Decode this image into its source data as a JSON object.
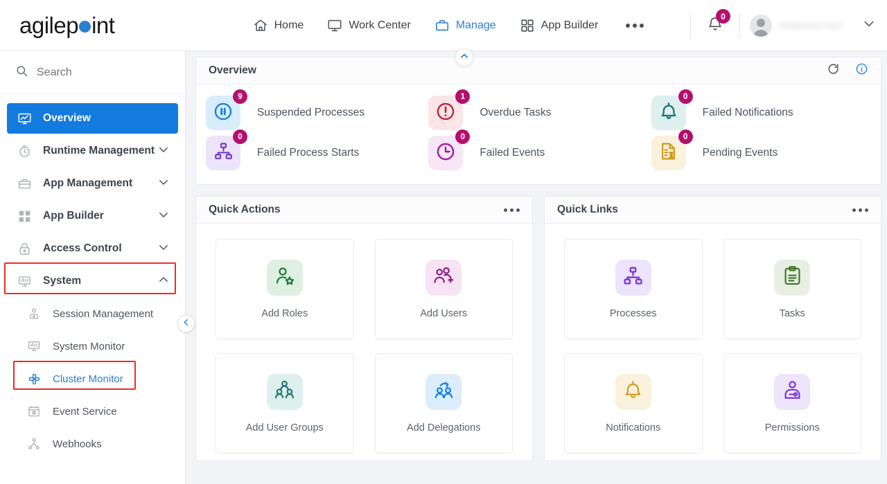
{
  "brand": {
    "name_part1": "agilep",
    "name_part2": "int",
    "dot_color": "#2a7dd1"
  },
  "topnav": {
    "items": [
      {
        "label": "Home",
        "icon": "home-icon",
        "active": false
      },
      {
        "label": "Work Center",
        "icon": "monitor-icon",
        "active": false
      },
      {
        "label": "Manage",
        "icon": "briefcase-icon",
        "active": true
      },
      {
        "label": "App Builder",
        "icon": "grid-icon",
        "active": false
      }
    ],
    "more_label": "more-options"
  },
  "header_right": {
    "notification_count": "0",
    "user_name": "redacted-user",
    "chevron": "chevron-down-icon"
  },
  "sidebar": {
    "search_placeholder": "Search",
    "items": [
      {
        "label": "Overview",
        "icon": "dashboard-icon",
        "active": true,
        "expandable": false
      },
      {
        "label": "Runtime Management",
        "icon": "clock-icon",
        "active": false,
        "expandable": true,
        "state": "collapsed"
      },
      {
        "label": "App Management",
        "icon": "briefcase-icon",
        "active": false,
        "expandable": true,
        "state": "collapsed"
      },
      {
        "label": "App Builder",
        "icon": "grid-icon",
        "active": false,
        "expandable": true,
        "state": "collapsed"
      },
      {
        "label": "Access Control",
        "icon": "lock-icon",
        "active": false,
        "expandable": true,
        "state": "collapsed"
      },
      {
        "label": "System",
        "icon": "system-monitor-icon",
        "active": false,
        "expandable": true,
        "state": "expanded",
        "highlighted": true
      }
    ],
    "system_children": [
      {
        "label": "Session Management",
        "icon": "user-card-icon",
        "selected": false
      },
      {
        "label": "System Monitor",
        "icon": "system-monitor-icon",
        "selected": false
      },
      {
        "label": "Cluster Monitor",
        "icon": "cluster-icon",
        "selected": true,
        "highlighted": true
      },
      {
        "label": "Event Service",
        "icon": "calendar-clock-icon",
        "selected": false
      },
      {
        "label": "Webhooks",
        "icon": "webhook-icon",
        "selected": false
      }
    ],
    "collapse_handle": "chevron-left-icon"
  },
  "overview": {
    "title": "Overview",
    "refresh_icon": "refresh-icon",
    "info_icon": "info-icon",
    "collapse_icon": "chevron-up-icon",
    "stats": [
      {
        "label": "Suspended Processes",
        "count": "9",
        "icon": "pause-circle-icon",
        "tile_bg": "#d9ecfb",
        "icon_color": "#1683e0"
      },
      {
        "label": "Overdue Tasks",
        "count": "1",
        "icon": "exclamation-circle-icon",
        "tile_bg": "#fbe5e7",
        "icon_color": "#c21f3a"
      },
      {
        "label": "Failed Notifications",
        "count": "0",
        "icon": "bell-icon",
        "tile_bg": "#ddf0ee",
        "icon_color": "#1f7a74"
      },
      {
        "label": "Failed Process Starts",
        "count": "0",
        "icon": "hierarchy-icon",
        "tile_bg": "#ece4fa",
        "icon_color": "#7a36d6"
      },
      {
        "label": "Failed Events",
        "count": "0",
        "icon": "clock-circle-icon",
        "tile_bg": "#f6e6f6",
        "icon_color": "#a01ba6"
      },
      {
        "label": "Pending Events",
        "count": "0",
        "icon": "pending-document-icon",
        "tile_bg": "#faf1dd",
        "icon_color": "#cf9b1c"
      }
    ]
  },
  "quick_actions": {
    "title": "Quick Actions",
    "menu_icon": "more-options-icon",
    "cards": [
      {
        "label": "Add Roles",
        "icon": "user-star-icon",
        "tile_bg": "#ddf0e1",
        "icon_color": "#1e7a37"
      },
      {
        "label": "Add Users",
        "icon": "user-plus-icon",
        "tile_bg": "#f7e3f4",
        "icon_color": "#8e1b8a"
      },
      {
        "label": "Add User Groups",
        "icon": "user-group-icon",
        "tile_bg": "#ddf0ee",
        "icon_color": "#1f7a74"
      },
      {
        "label": "Add Delegations",
        "icon": "user-delegate-icon",
        "tile_bg": "#dbecfb",
        "icon_color": "#1683e0"
      }
    ]
  },
  "quick_links": {
    "title": "Quick Links",
    "menu_icon": "more-options-icon",
    "cards": [
      {
        "label": "Processes",
        "icon": "hierarchy-icon",
        "tile_bg": "#ece4fa",
        "icon_color": "#7a36d6"
      },
      {
        "label": "Tasks",
        "icon": "clipboard-icon",
        "tile_bg": "#e9eee4",
        "icon_color": "#3c7a29"
      },
      {
        "label": "Notifications",
        "icon": "bell-icon",
        "tile_bg": "#faf1dd",
        "icon_color": "#cf9b1c"
      },
      {
        "label": "Permissions",
        "icon": "user-key-icon",
        "tile_bg": "#ece4fa",
        "icon_color": "#7a36d6"
      }
    ]
  }
}
